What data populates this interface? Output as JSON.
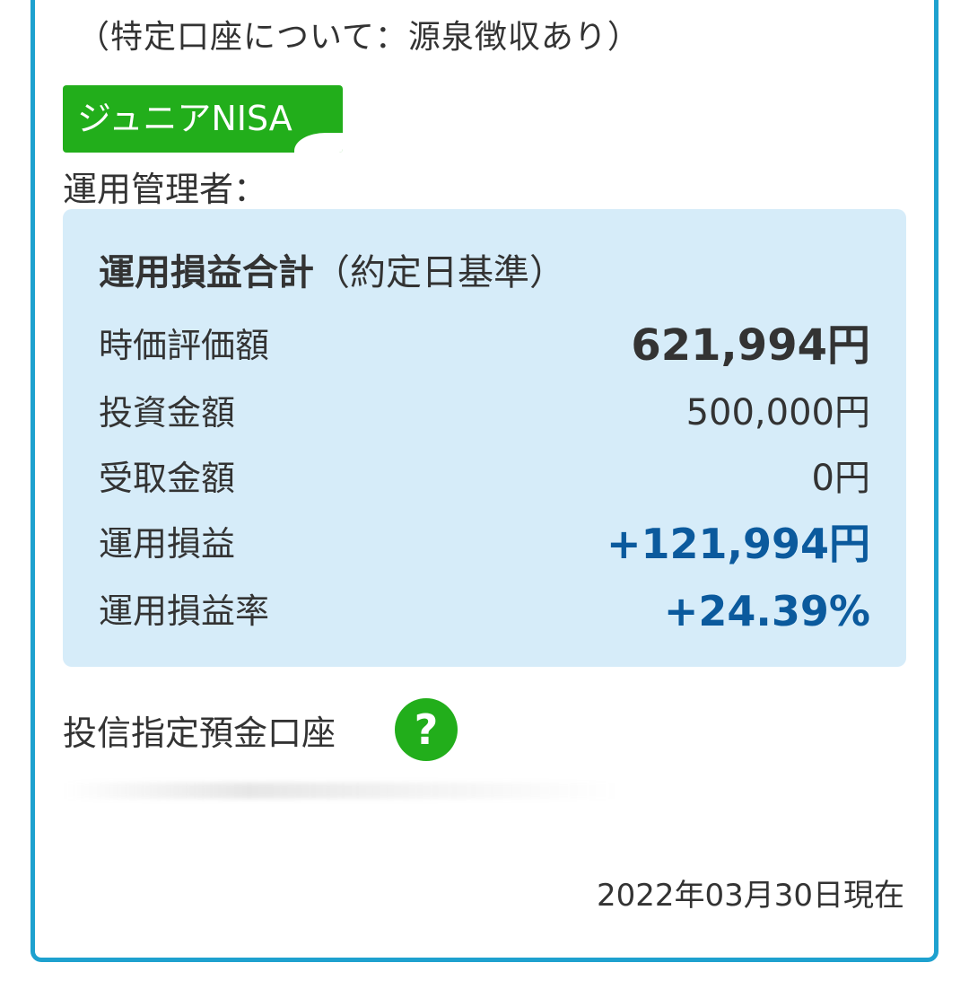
{
  "account_note": "（特定口座について：源泉徴収あり）",
  "nisa_tag": "ジュニアNISA",
  "manager_label": "運用管理者：",
  "summary": {
    "title_bold": "運用損益合計",
    "title_sub": "（約定日基準）",
    "rows": [
      {
        "label": "時価評価額",
        "value": "621,994円"
      },
      {
        "label": "投資金額",
        "value": "500,000円"
      },
      {
        "label": "受取金額",
        "value": "0円"
      },
      {
        "label": "運用損益",
        "value": "+121,994円"
      },
      {
        "label": "運用損益率",
        "value": "+24.39%"
      }
    ]
  },
  "fund_account_label": "投信指定預金口座",
  "help_icon_glyph": "?",
  "as_of_date": "2022年03月30日現在",
  "colors": {
    "frame_border": "#1ea1cf",
    "tag_green": "#22ae1b",
    "summary_bg": "#d6ecf9",
    "gain_blue": "#0b5a9d"
  }
}
